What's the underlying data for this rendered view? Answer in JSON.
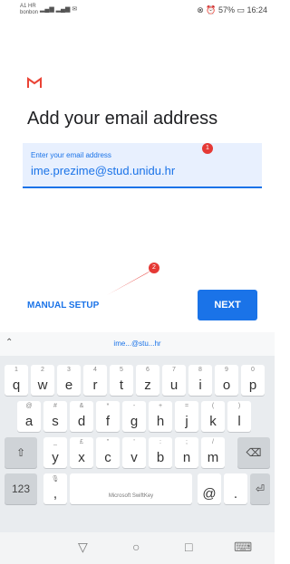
{
  "status_bar": {
    "carrier": "A1 HR",
    "carrier2": "bonbon",
    "right_text": "⊗ ⏰ 57% ▭ 16:24"
  },
  "header": {
    "title": "Add your email address"
  },
  "email_field": {
    "label": "Enter your email address",
    "value": "ime.prezime@stud.unidu.hr"
  },
  "actions": {
    "manual_setup": "MANUAL SETUP",
    "next": "NEXT"
  },
  "annotations": [
    "1",
    "2"
  ],
  "keyboard": {
    "suggestion": "ime...@stu...hr",
    "brand": "Microsoft SwiftKey",
    "num_key": "123",
    "row1": [
      {
        "num": "1",
        "ch": "q"
      },
      {
        "num": "2",
        "ch": "w"
      },
      {
        "num": "3",
        "ch": "e"
      },
      {
        "num": "4",
        "ch": "r"
      },
      {
        "num": "5",
        "ch": "t"
      },
      {
        "num": "6",
        "ch": "z"
      },
      {
        "num": "7",
        "ch": "u"
      },
      {
        "num": "8",
        "ch": "i"
      },
      {
        "num": "9",
        "ch": "o"
      },
      {
        "num": "0",
        "ch": "p"
      }
    ],
    "row2": [
      {
        "num": "@",
        "ch": "a"
      },
      {
        "num": "#",
        "ch": "s"
      },
      {
        "num": "&",
        "ch": "d"
      },
      {
        "num": "*",
        "ch": "f"
      },
      {
        "num": "-",
        "ch": "g"
      },
      {
        "num": "+",
        "ch": "h"
      },
      {
        "num": "=",
        "ch": "j"
      },
      {
        "num": "(",
        "ch": "k"
      },
      {
        "num": ")",
        "ch": "l"
      }
    ],
    "row3": [
      {
        "num": "_",
        "ch": "y"
      },
      {
        "num": "£",
        "ch": "x"
      },
      {
        "num": "\"",
        "ch": "c"
      },
      {
        "num": "'",
        "ch": "v"
      },
      {
        "num": ":",
        "ch": "b"
      },
      {
        "num": ";",
        "ch": "n"
      },
      {
        "num": "/",
        "ch": "m"
      }
    ],
    "row4": [
      {
        "num": "",
        "ch": ","
      },
      {
        "num": "",
        "ch": "@"
      },
      {
        "num": "",
        "ch": "."
      }
    ]
  },
  "colors": {
    "accent": "#1a73e8",
    "badge": "#e53935",
    "gmail_red": "#ea4335"
  }
}
